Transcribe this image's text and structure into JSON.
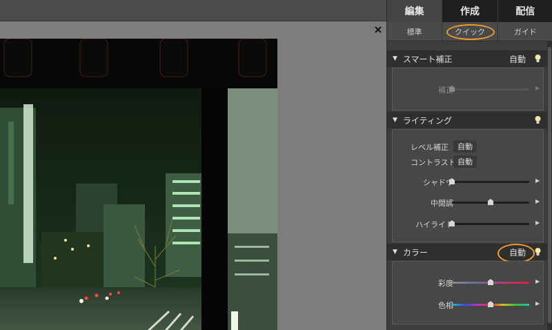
{
  "mode_tabs": [
    "編集",
    "作成",
    "配信"
  ],
  "sub_tabs": [
    "標準",
    "クイック",
    "ガイド"
  ],
  "close_glyph": "×",
  "smart_fix": {
    "title": "スマート補正",
    "auto_label": "自動",
    "slider": {
      "label": "補正",
      "value": 0.0
    }
  },
  "lighting": {
    "title": "ライティング",
    "levels_label": "レベル補正",
    "levels_button": "自動",
    "contrast_label": "コントラスト",
    "contrast_button": "自動",
    "sliders": [
      {
        "label": "シャドウ",
        "value": 0.0
      },
      {
        "label": "中間調",
        "value": 0.5
      },
      {
        "label": "ハイライト",
        "value": 0.0
      }
    ]
  },
  "color": {
    "title": "カラー",
    "auto_label": "自動",
    "sliders": [
      {
        "label": "彩度",
        "value": 0.5
      },
      {
        "label": "色相",
        "value": 0.5
      }
    ]
  },
  "colors": {
    "annotation": "#f39c2c",
    "bulb": "#f2e6a0"
  },
  "icons": {
    "section_toggle": "triangle-down-icon",
    "tip": "lightbulb-icon",
    "close": "close-icon",
    "slider_end": "triangle-right-icon"
  }
}
